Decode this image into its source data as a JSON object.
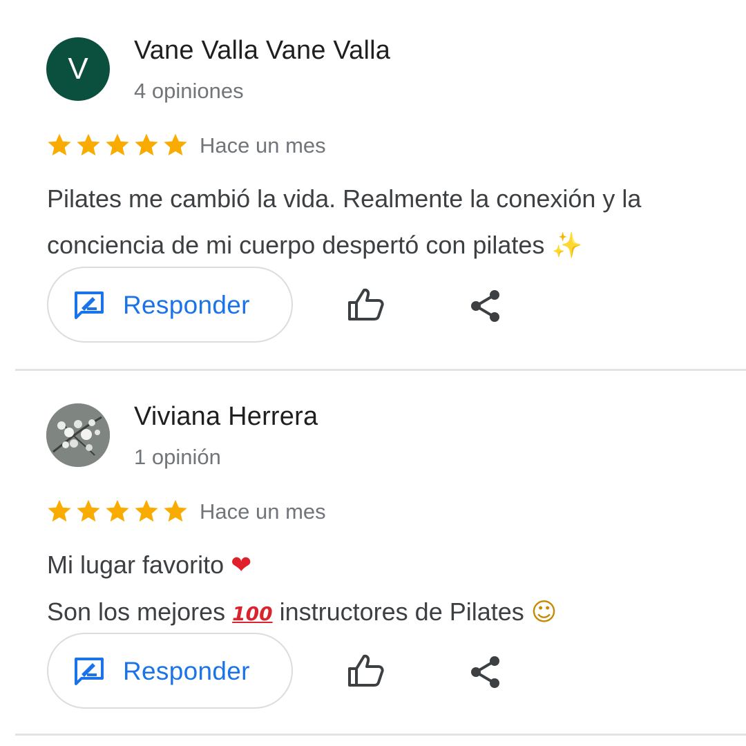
{
  "reviews": [
    {
      "author": "Vane Valla Vane Valla",
      "avatar_letter": "V",
      "review_count": "4 opiniones",
      "rating": 5,
      "time": "Hace un mes",
      "text_lines": [
        "Pilates me cambió la vida. Realmente la conexión y la",
        "conciencia de mi cuerpo despertó con pilates"
      ],
      "emoji_line2": "✨",
      "reply_label": "Responder"
    },
    {
      "author": "Viviana Herrera",
      "avatar_icon": "flower-photo-avatar",
      "review_count": "1 opinión",
      "rating": 5,
      "time": "Hace un mes",
      "line1": "Mi lugar favorito",
      "line1_emoji": "❤",
      "line2_a": "Son los mejores",
      "line2_emoji": "100",
      "line2_b": "instructores de Pilates",
      "line2_emoji_end": "☺",
      "reply_label": "Responder"
    }
  ],
  "icons": {
    "star": "star-icon",
    "reply": "reply-icon",
    "like": "thumbs-up-icon",
    "share": "share-icon"
  },
  "colors": {
    "star": "#f9ab00",
    "accent": "#1a73e8",
    "avatar_bg": "#0b4f3f",
    "secondary_text": "#70757a",
    "icon": "#3c4043"
  }
}
